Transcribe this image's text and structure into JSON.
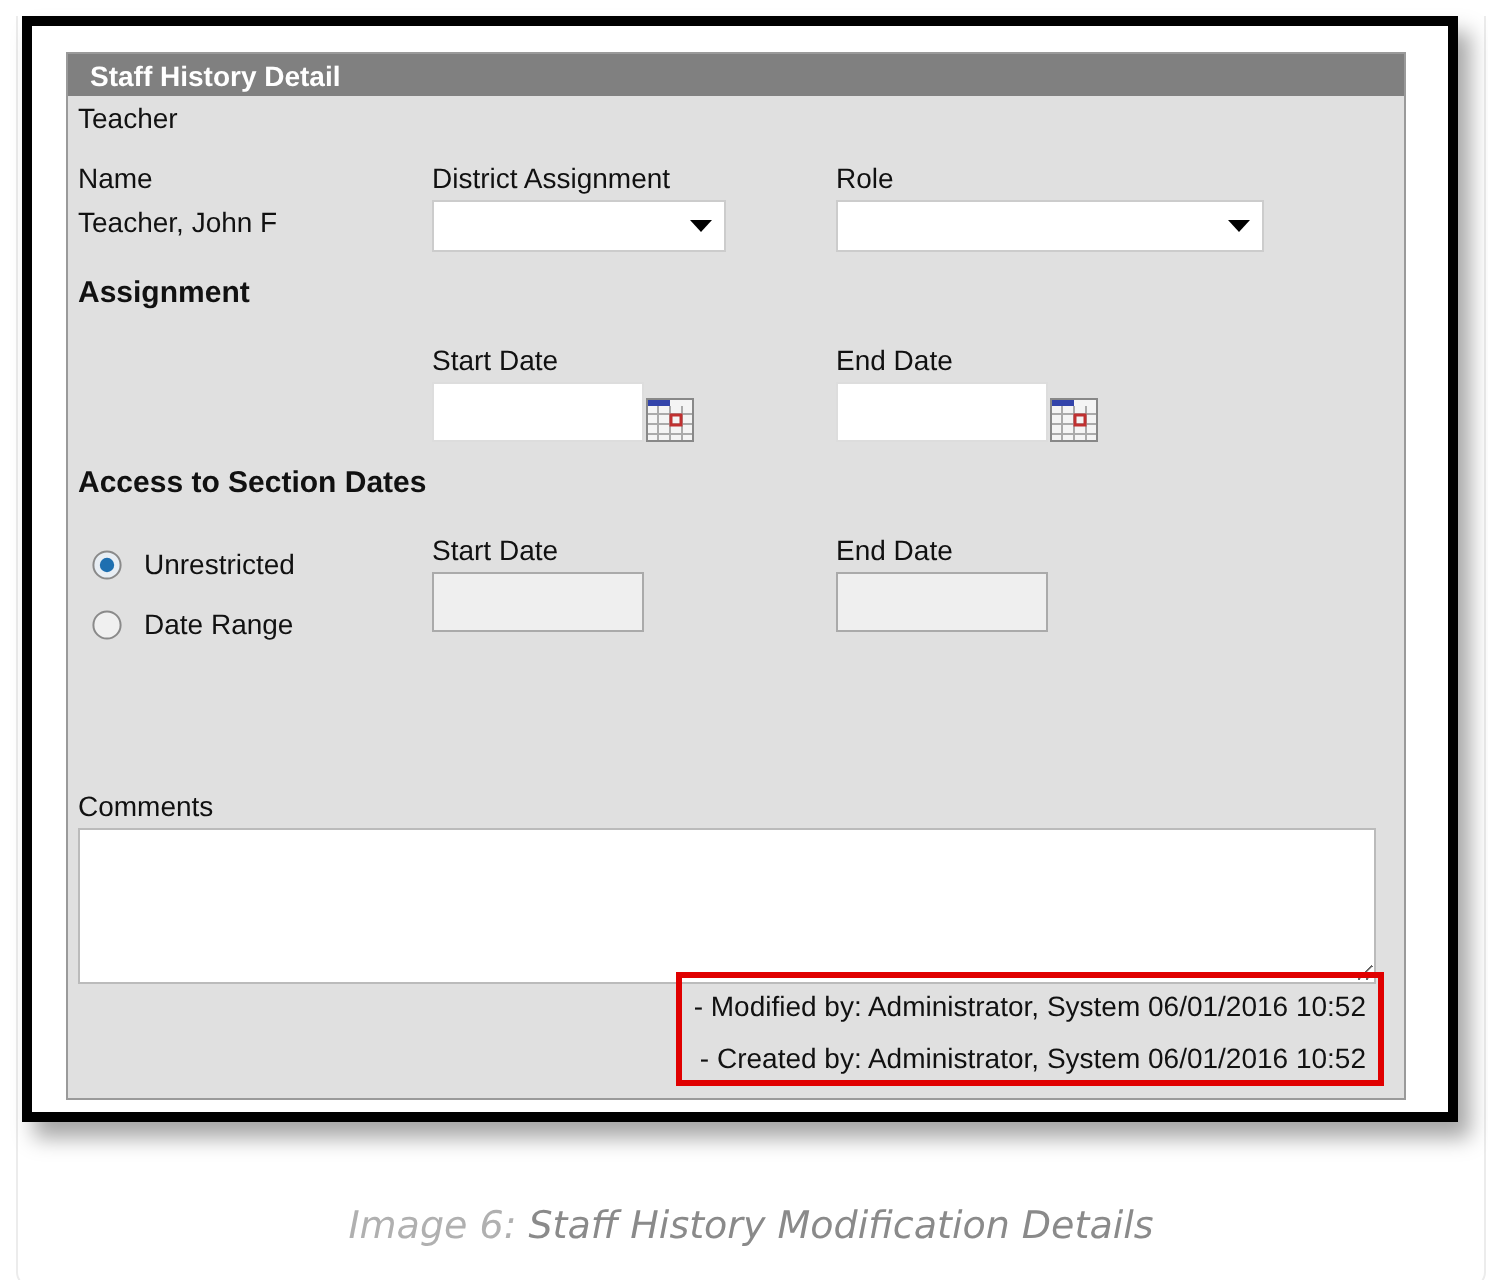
{
  "panel": {
    "title": "Staff History Detail",
    "subtitle": "Teacher",
    "name": {
      "label": "Name",
      "value": "Teacher, John F"
    },
    "district_assignment": {
      "label": "District Assignment"
    },
    "role": {
      "label": "Role"
    },
    "assignment": {
      "heading": "Assignment",
      "start_date": {
        "label": "Start Date",
        "disabled": false
      },
      "end_date": {
        "label": "End Date",
        "disabled": false
      }
    },
    "access": {
      "heading": "Access to Section Dates",
      "options": [
        {
          "label": "Unrestricted",
          "selected": true
        },
        {
          "label": "Date Range",
          "selected": false
        }
      ],
      "start_date": {
        "label": "Start Date",
        "disabled": true
      },
      "end_date": {
        "label": "End Date",
        "disabled": true
      }
    },
    "comments": {
      "label": "Comments"
    },
    "audit": [
      "- Modified by: Administrator, System 06/01/2016 10:52",
      "- Created by: Administrator, System 06/01/2016 10:52"
    ]
  },
  "caption": {
    "label": "Image 6:",
    "title": "Staff History Modification Details"
  }
}
